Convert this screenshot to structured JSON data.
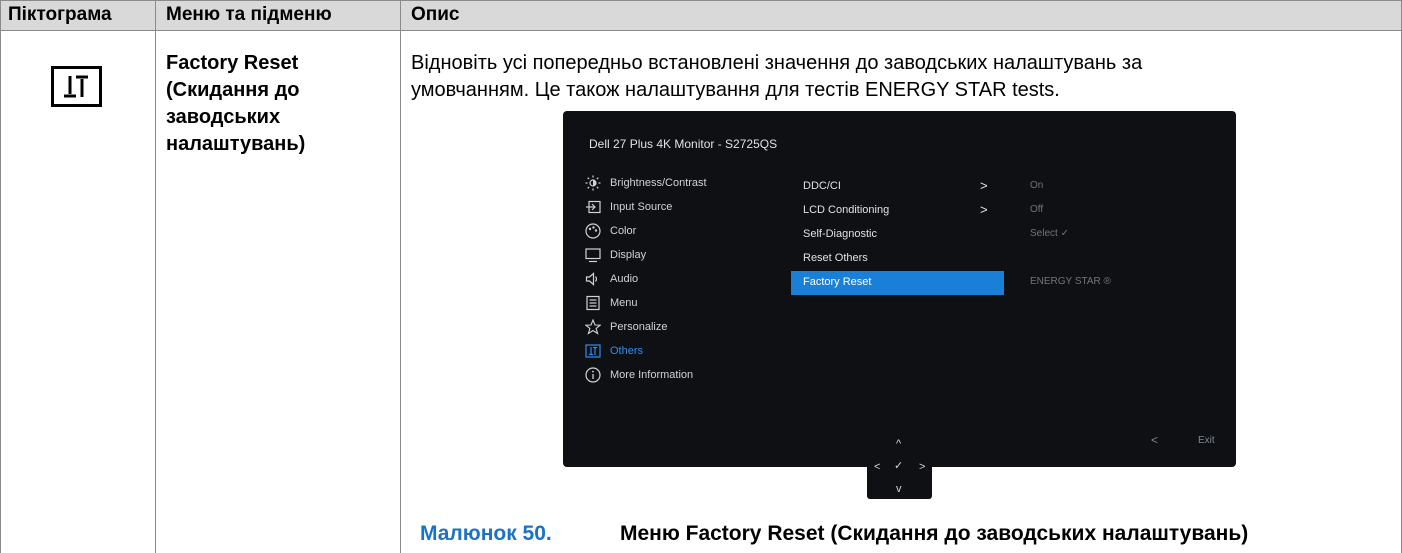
{
  "table": {
    "headers": [
      "Піктограма",
      "Меню та підменю",
      "Опис"
    ],
    "row": {
      "menu_lines": [
        "Factory Reset",
        "(Скидання до",
        "заводських",
        "налаштувань)"
      ],
      "desc_lines": [
        "Відновіть усі попередньо встановлені значення до заводських налаштувань за",
        "умовчанням. Це також налаштування для тестів ENERGY STAR tests."
      ]
    }
  },
  "osd": {
    "title": "Dell 27 Plus 4K Monitor - S2725QS",
    "menu": [
      {
        "label": "Brightness/Contrast",
        "icon": "brightness-icon"
      },
      {
        "label": "Input Source",
        "icon": "input-source-icon"
      },
      {
        "label": "Color",
        "icon": "color-palette-icon"
      },
      {
        "label": "Display",
        "icon": "display-icon"
      },
      {
        "label": "Audio",
        "icon": "speaker-icon"
      },
      {
        "label": "Menu",
        "icon": "menu-list-icon"
      },
      {
        "label": "Personalize",
        "icon": "star-icon"
      },
      {
        "label": "Others",
        "icon": "others-icon",
        "active": true
      },
      {
        "label": "More Information",
        "icon": "info-icon"
      }
    ],
    "submenu": [
      {
        "label": "DDC/CI",
        "arrow": ">",
        "value": "On"
      },
      {
        "label": "LCD Conditioning",
        "arrow": ">",
        "value": "Off"
      },
      {
        "label": "Self-Diagnostic",
        "arrow": "",
        "value": "Select ✓"
      },
      {
        "label": "Reset Others",
        "arrow": "",
        "value": ""
      },
      {
        "label": "Factory Reset",
        "arrow": "",
        "value": "ENERGY STAR ®",
        "selected": true
      }
    ],
    "footer": {
      "back": "<",
      "exit": "Exit"
    },
    "joystick": {
      "up": "^",
      "left": "<",
      "center": "✓",
      "right": ">",
      "down": "v"
    },
    "colors": {
      "background": "#0e1013",
      "highlight": "#1a7fd6",
      "active_text": "#2f8ff0"
    }
  },
  "caption": {
    "number": "Малюнок 50.",
    "text": "Меню Factory Reset (Скидання до заводських налаштувань)"
  }
}
